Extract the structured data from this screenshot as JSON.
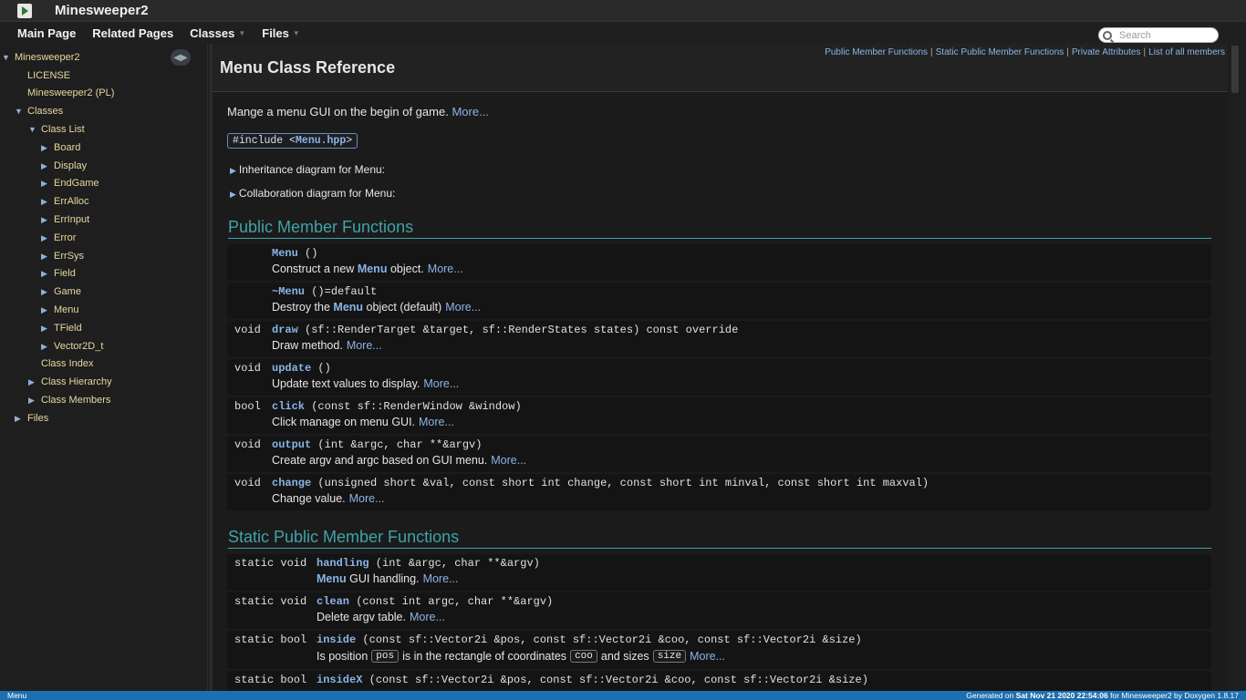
{
  "titlebar": {
    "title": "Minesweeper2"
  },
  "navbar": {
    "items": [
      {
        "label": "Main Page"
      },
      {
        "label": "Related Pages"
      },
      {
        "label": "Classes"
      },
      {
        "label": "Files"
      }
    ],
    "search_placeholder": "Search"
  },
  "sidebar": {
    "root": "Minesweeper2",
    "license": "LICENSE",
    "pl": "Minesweeper2 (PL)",
    "classes": "Classes",
    "class_list": "Class List",
    "class_items": [
      "Board",
      "Display",
      "EndGame",
      "ErrAlloc",
      "ErrInput",
      "Error",
      "ErrSys",
      "Field",
      "Game",
      "Menu",
      "TField",
      "Vector2D_t"
    ],
    "class_index": "Class Index",
    "class_hierarchy": "Class Hierarchy",
    "class_members": "Class Members",
    "files": "Files"
  },
  "header": {
    "title": "Menu Class Reference",
    "links": [
      "Public Member Functions",
      "Static Public Member Functions",
      "Private Attributes",
      "List of all members"
    ]
  },
  "intro": {
    "text": "Mange a menu GUI on the begin of game.",
    "more": "More...",
    "include_prefix": "#include <",
    "include_file": "Menu.hpp",
    "include_suffix": ">",
    "inheritance": "Inheritance diagram for Menu:",
    "collaboration": "Collaboration diagram for Menu:"
  },
  "public_section": {
    "title": "Public Member Functions",
    "members": [
      {
        "type": "",
        "name": "Menu",
        "args": " ()",
        "desc_pre": "Construct a new ",
        "desc_bold": "Menu",
        "desc_post": " object.",
        "more": "More..."
      },
      {
        "type": "",
        "name": "~Menu",
        "args": " ()=default",
        "desc_pre": "Destroy the ",
        "desc_bold": "Menu",
        "desc_post": " object (default)",
        "more": "More..."
      },
      {
        "type": "void",
        "name": "draw",
        "args": " (sf::RenderTarget &target, sf::RenderStates states) const override",
        "desc_pre": "Draw method.",
        "desc_bold": "",
        "desc_post": "",
        "more": "More..."
      },
      {
        "type": "void",
        "name": "update",
        "args": " ()",
        "desc_pre": "Update text values to display.",
        "desc_bold": "",
        "desc_post": "",
        "more": "More..."
      },
      {
        "type": "bool",
        "name": "click",
        "args": " (const sf::RenderWindow &window)",
        "desc_pre": "Click manage on menu GUI.",
        "desc_bold": "",
        "desc_post": "",
        "more": "More..."
      },
      {
        "type": "void",
        "name": "output",
        "args": " (int &argc, char **&argv)",
        "desc_pre": "Create argv and argc based on GUI menu.",
        "desc_bold": "",
        "desc_post": "",
        "more": "More..."
      },
      {
        "type": "void",
        "name": "change",
        "args": " (unsigned short &val, const short int change, const short int minval, const short int maxval)",
        "desc_pre": "Change value.",
        "desc_bold": "",
        "desc_post": "",
        "more": "More..."
      }
    ]
  },
  "static_section": {
    "title": "Static Public Member Functions",
    "members": [
      {
        "type": "static void",
        "name": "handling",
        "args": " (int &argc, char **&argv)",
        "desc_bold": "Menu",
        "desc_post": " GUI handling.",
        "more": "More..."
      },
      {
        "type": "static void",
        "name": "clean",
        "args": " (const int argc, char **&argv)",
        "desc_pre": "Delete argv table.",
        "more": "More..."
      },
      {
        "type": "static bool",
        "name": "inside",
        "args": " (const sf::Vector2i &pos, const sf::Vector2i &coo, const sf::Vector2i &size)",
        "desc_a": "Is position",
        "p1": "pos",
        "desc_b": "is in the rectangle of coordinates",
        "p2": "coo",
        "desc_c": "and sizes",
        "p3": "size",
        "more": "More..."
      },
      {
        "type": "static bool",
        "name": "insideX",
        "args": " (const sf::Vector2i &pos, const sf::Vector2i &coo, const sf::Vector2i &size)"
      }
    ]
  },
  "footer": {
    "crumb": "Menu",
    "gen_pre": "Generated on",
    "gen_date": "Sat Nov 21 2020 22:54:06",
    "gen_mid": "for Minesweeper2 by",
    "gen_tool": "Doxygen",
    "gen_ver": "1.8.17"
  }
}
